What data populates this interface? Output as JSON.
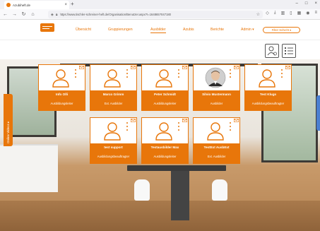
{
  "browser": {
    "tab_title": "Azubiheft.de",
    "url": "https://www.tischler-schreiner-heft.de/Organisation/Benutzer.aspx?I=164865?047180",
    "tab_close": "×",
    "new_tab": "+"
  },
  "app": {
    "menu": [
      {
        "label": "Übersicht"
      },
      {
        "label": "Gruppierungen"
      },
      {
        "label": "Ausbilder"
      },
      {
        "label": "Azubis"
      },
      {
        "label": "Berichte"
      },
      {
        "label": "Admin ▾"
      }
    ],
    "filter_label": "Filter Schicht ▾",
    "side_tab_label": "Online Videos ▸"
  },
  "cards": [
    {
      "name": "Info Olli",
      "role": "Ausbildungsleiter",
      "photo": false
    },
    {
      "name": "Marco Grimm",
      "role": "Ext. Ausbilder",
      "photo": false
    },
    {
      "name": "Peter Schmidt",
      "role": "Ausbildungsleiter",
      "photo": false
    },
    {
      "name": "Silvio Mustermann",
      "role": "Ausbilder",
      "photo": true
    },
    {
      "name": "Test Klugs",
      "role": "Ausbildungsbeauftragter",
      "photo": false
    },
    {
      "name": "test support",
      "role": "Ausbildungsbeauftragter",
      "photo": false
    },
    {
      "name": "Testausbilder Max",
      "role": "Ausbildungsleiter",
      "photo": false
    },
    {
      "name": "TestExt AusbExt",
      "role": "Ext. Ausbilder",
      "photo": false
    }
  ],
  "colors": {
    "accent": "#e8760a"
  }
}
